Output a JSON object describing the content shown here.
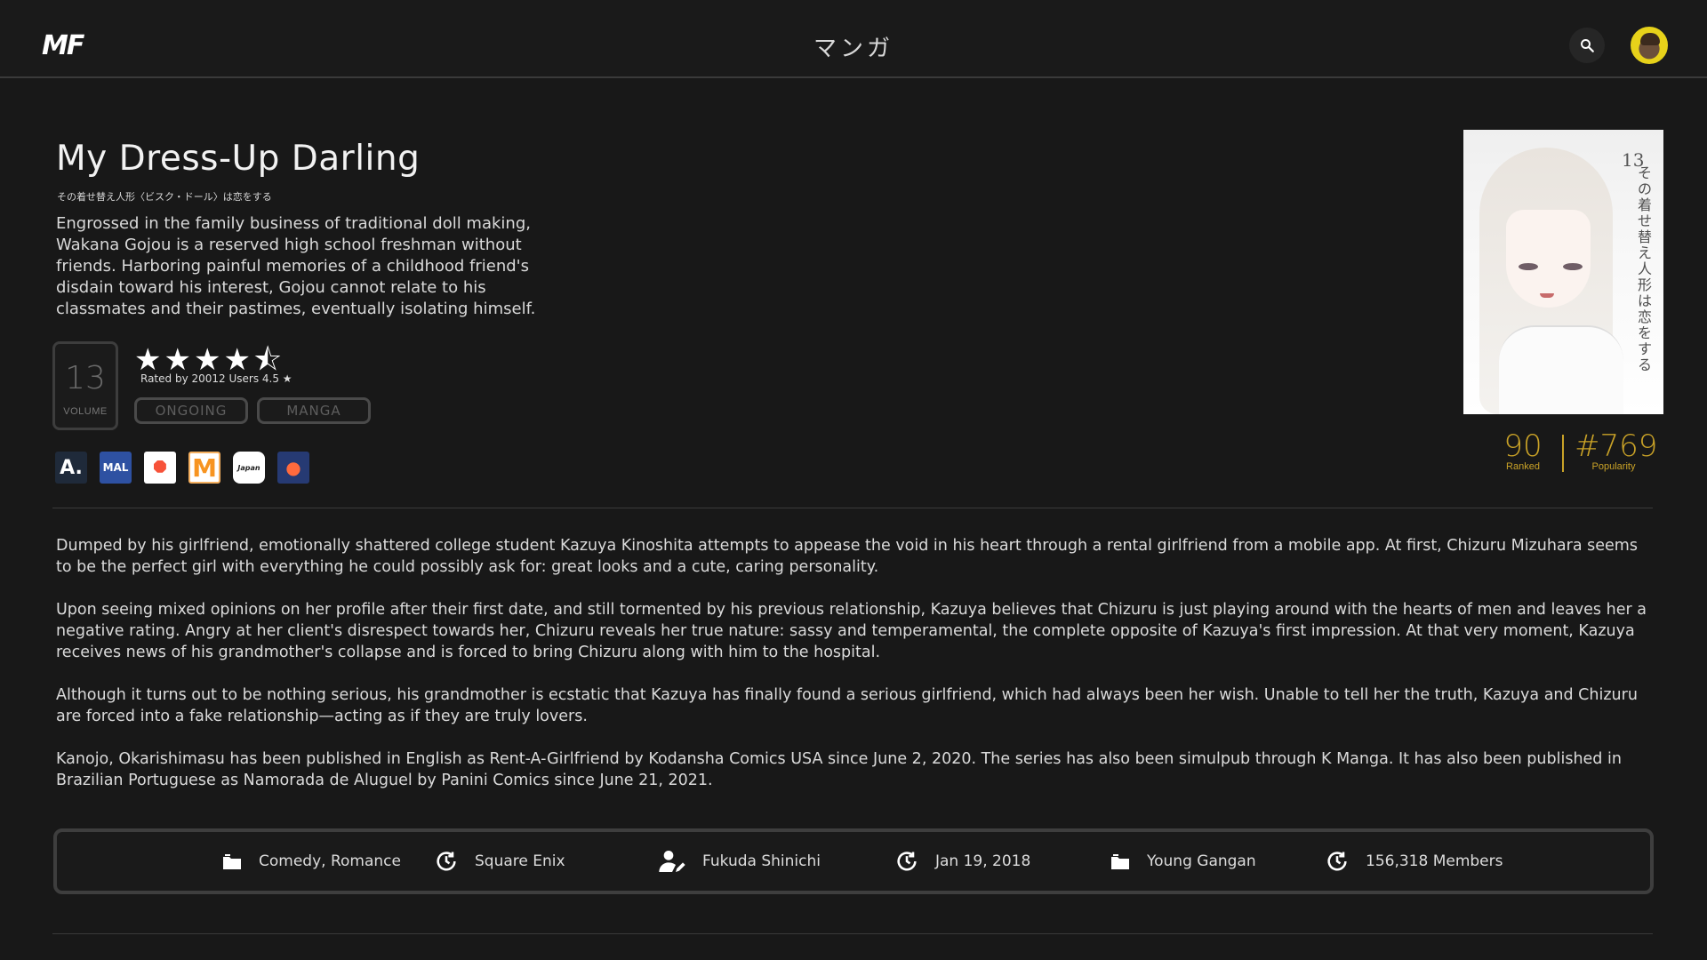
{
  "header": {
    "logo": "MF",
    "title": "マンガ",
    "search_icon": "search-icon",
    "avatar": "user-avatar"
  },
  "manga": {
    "title": "My Dress-Up Darling",
    "title_jp": "その着せ替え人形〈ビスク・ドール〉は恋をする",
    "short_synopsis": "Engrossed in the family business of traditional doll making, Wakana Gojou is a reserved high school freshman without friends. Harboring painful memories of a childhood friend's disdain toward his interest, Gojou cannot relate to his classmates and their pastimes, eventually isolating himself.",
    "volume_count": "13",
    "volume_label": "VOLUME",
    "stars": "★★★★⯪",
    "rating_value": 4.5,
    "rated_line": "Rated by 20012 Users 4.5 ★",
    "status_pill": "ONGOING",
    "type_pill": "MANGA",
    "cover": {
      "volume_mark": "13",
      "jp_text": "その着せ替え人形は恋をする"
    },
    "rank": "90",
    "rank_label": "Ranked",
    "popularity": "#769",
    "popularity_label": "Popularity"
  },
  "sources": [
    {
      "name": "anilist",
      "glyph": "A."
    },
    {
      "name": "myanimelist",
      "glyph": "MAL"
    },
    {
      "name": "kitsu",
      "glyph": "⯃"
    },
    {
      "name": "mangaupdates",
      "glyph": "M"
    },
    {
      "name": "japan",
      "glyph": "Japan"
    },
    {
      "name": "planet",
      "glyph": "●"
    }
  ],
  "long_synopsis": [
    "Dumped by his girlfriend, emotionally shattered college student Kazuya Kinoshita attempts to appease the void in his heart through a rental girlfriend from a mobile app. At first, Chizuru Mizuhara seems to be the perfect girl with everything he could possibly ask for: great looks and a cute, caring personality.",
    "Upon seeing mixed opinions on her profile after their first date, and still tormented by his previous relationship, Kazuya believes that Chizuru is just playing around with the hearts of men and leaves her a negative rating. Angry at her client's disrespect towards her, Chizuru reveals her true nature: sassy and temperamental, the complete opposite of Kazuya's first impression. At that very moment, Kazuya receives news of his grandmother's collapse and is forced to bring Chizuru along with him to the hospital.",
    "Although it turns out to be nothing serious, his grandmother is ecstatic that Kazuya has finally found a serious girlfriend, which had always been her wish. Unable to tell her the truth, Kazuya and Chizuru are forced into a fake relationship—acting as if they are truly lovers.",
    "Kanojo, Okarishimasu has been published in English as Rent-A-Girlfriend by Kodansha Comics USA since June 2, 2020. The series has also been simulpub through K Manga. It has also been published in Brazilian Portuguese as Namorada de Aluguel by Panini Comics since June 21, 2021."
  ],
  "info": {
    "genres": "Comedy, Romance",
    "studio": "Square Enix",
    "author": "Fukuda Shinichi",
    "date": "Jan 19, 2018",
    "magazine": "Young Gangan",
    "members": "156,318 Members"
  },
  "colors": {
    "background": "#181818",
    "accent_gold": "#c9a227",
    "border": "#3e3e3e"
  }
}
